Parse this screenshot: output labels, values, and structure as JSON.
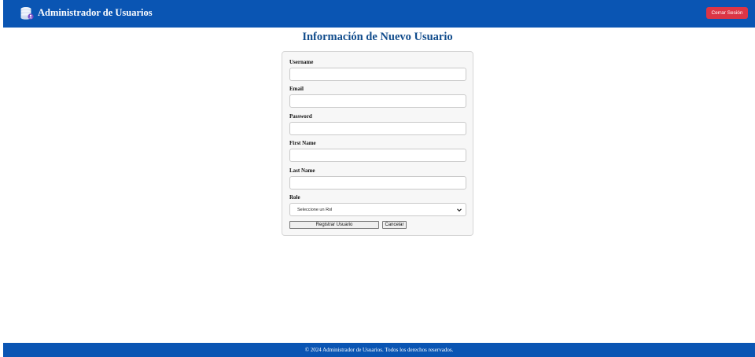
{
  "header": {
    "title": "Administrador de Usuarios",
    "logout_label": "Cerrar Sesión"
  },
  "page": {
    "title": "Información de Nuevo Usuario"
  },
  "form": {
    "fields": [
      {
        "label": "Username",
        "value": ""
      },
      {
        "label": "Email",
        "value": ""
      },
      {
        "label": "Password",
        "value": ""
      },
      {
        "label": "First Name",
        "value": ""
      },
      {
        "label": "Last Name",
        "value": ""
      }
    ],
    "role": {
      "label": "Role",
      "selected": "Seleccione un Rol"
    },
    "submit_label": "Registrar Usuario",
    "cancel_label": "Cancelar"
  },
  "footer": {
    "text": "© 2024 Administrador de Usuarios. Todos los derechos reservados."
  },
  "colors": {
    "brand": "#0a55b3",
    "title": "#114c8c",
    "danger": "#dc3545"
  }
}
